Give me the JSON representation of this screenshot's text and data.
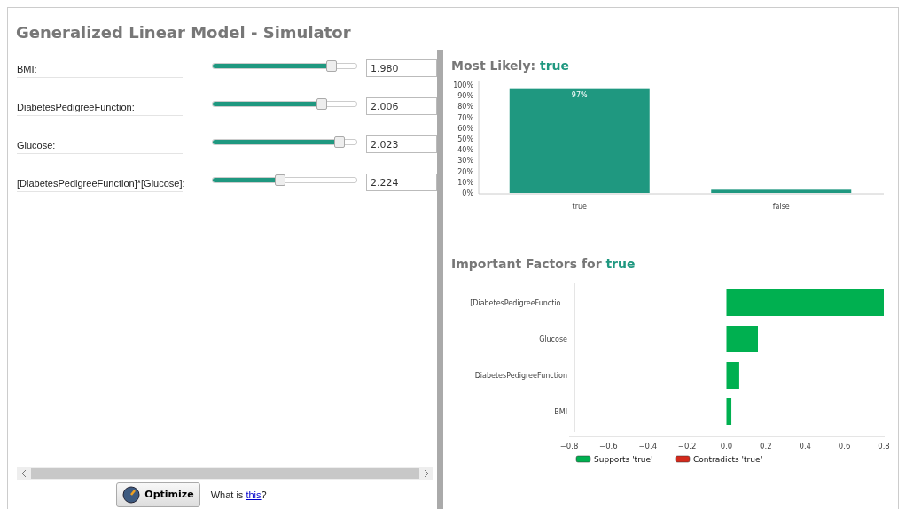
{
  "title": "Generalized Linear Model - Simulator",
  "attributes": [
    {
      "label": "BMI:",
      "level": 0.83,
      "value": "1.980"
    },
    {
      "label": "DiabetesPedigreeFunction:",
      "level": 0.76,
      "value": "2.006"
    },
    {
      "label": "Glucose:",
      "level": 0.88,
      "value": "2.023"
    },
    {
      "label": "[DiabetesPedigreeFunction]*[Glucose]:",
      "level": 0.47,
      "value": "2.224"
    }
  ],
  "optimize_button": "Optimize",
  "help": {
    "text": "What is ",
    "link": "this",
    "suffix": "?"
  },
  "most_likely": {
    "heading": "Most Likely: ",
    "value": "true",
    "chart_data": {
      "type": "bar",
      "categories": [
        "true",
        "false"
      ],
      "values": [
        97,
        3
      ],
      "ylim": [
        0,
        100
      ],
      "yticks": [
        {
          "value": 0,
          "label": "0%"
        },
        {
          "value": 10,
          "label": "10%"
        },
        {
          "value": 20,
          "label": "20%"
        },
        {
          "value": 30,
          "label": "30%"
        },
        {
          "value": 40,
          "label": "40%"
        },
        {
          "value": 50,
          "label": "50%"
        },
        {
          "value": 60,
          "label": "60%"
        },
        {
          "value": 70,
          "label": "70%"
        },
        {
          "value": 80,
          "label": "80%"
        },
        {
          "value": 90,
          "label": "90%"
        },
        {
          "value": 100,
          "label": "100%"
        }
      ],
      "value_labels": [
        "97%",
        null
      ]
    }
  },
  "important_factors": {
    "heading": "Important Factors for ",
    "value": "true",
    "chart_data": {
      "type": "bar",
      "orientation": "horizontal",
      "categories": [
        "[DiabetesPedigreeFunctio...",
        "Glucose",
        "DiabetesPedigreeFunction",
        "BMI"
      ],
      "series": [
        {
          "name": "Supports 'true'",
          "color": "#00b050",
          "values": [
            0.8,
            0.16,
            0.065,
            0.025
          ]
        },
        {
          "name": "Contradicts 'true'",
          "color": "#d42a1c",
          "values": [
            null,
            null,
            null,
            null
          ]
        }
      ],
      "xlim": [
        -0.8,
        0.8
      ],
      "xticks": [
        {
          "value": -0.8,
          "label": "−0.8"
        },
        {
          "value": -0.6,
          "label": "−0.6"
        },
        {
          "value": -0.4,
          "label": "−0.4"
        },
        {
          "value": -0.2,
          "label": "−0.2"
        },
        {
          "value": 0,
          "label": "0.0"
        },
        {
          "value": 0.2,
          "label": "0.2"
        },
        {
          "value": 0.4,
          "label": "0.4"
        },
        {
          "value": 0.6,
          "label": "0.6"
        },
        {
          "value": 0.8,
          "label": "0.8"
        }
      ]
    }
  }
}
